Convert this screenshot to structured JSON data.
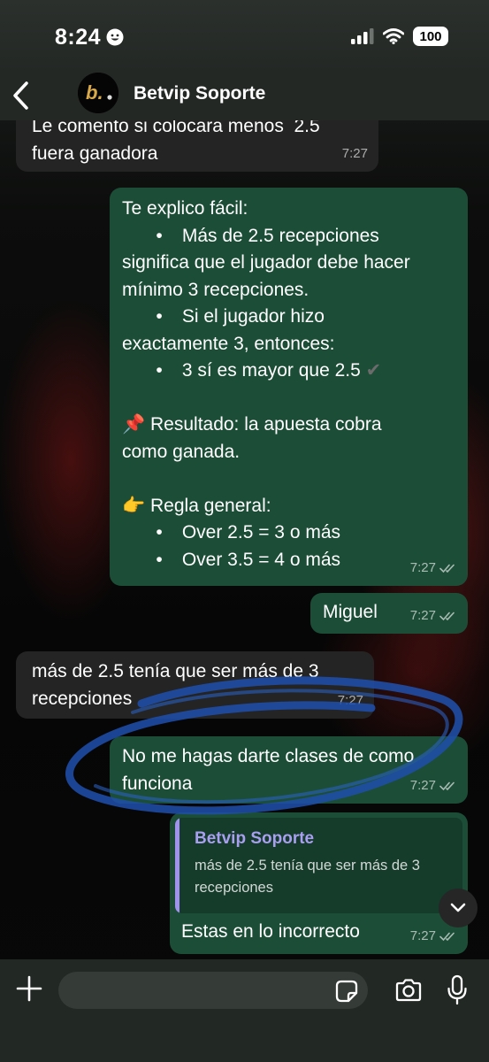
{
  "status_bar": {
    "time": "8:24",
    "battery": "100"
  },
  "header": {
    "contact_name": "Betvip Soporte",
    "avatar_letter": "b."
  },
  "messages": [
    {
      "direction": "incoming",
      "text": "Le comento si colocara menos  2.5\nfuera ganadora",
      "time": "7:27"
    },
    {
      "direction": "outgoing",
      "lines": [
        "Te explico fácil:",
        "•\tMás de 2.5 recepciones",
        "significa que el jugador debe hacer",
        "mínimo 3 recepciones.",
        "•\tSi el jugador hizo",
        "exactamente 3, entonces:",
        "•\t3 sí es mayor que 2.5 ✔️",
        "",
        "📌 Resultado: la apuesta cobra",
        "como ganada.",
        "",
        "👉 Regla general:",
        "•\tOver 2.5 = 3 o más",
        "•\tOver 3.5 = 4 o más"
      ],
      "time": "7:27"
    },
    {
      "direction": "outgoing",
      "text": "Miguel",
      "time": "7:27"
    },
    {
      "direction": "incoming",
      "text": "más de 2.5 tenía que ser más de 3\nrecepciones",
      "time": "7:27"
    },
    {
      "direction": "outgoing",
      "text": "No me hagas darte clases de como\nfunciona",
      "time": "7:27"
    },
    {
      "direction": "outgoing",
      "quote_author": "Betvip Soporte",
      "quote_text": "más de 2.5 tenía que ser más de 3\nrecepciones",
      "text": "Estas en lo incorrecto",
      "time": "7:27"
    }
  ],
  "input": {
    "value": ""
  },
  "colors": {
    "outgoing_bubble": "#1c4e37",
    "incoming_bubble": "#242424",
    "quote_author": "#a99ff0",
    "drawn_circle": "#1f4fa8"
  }
}
